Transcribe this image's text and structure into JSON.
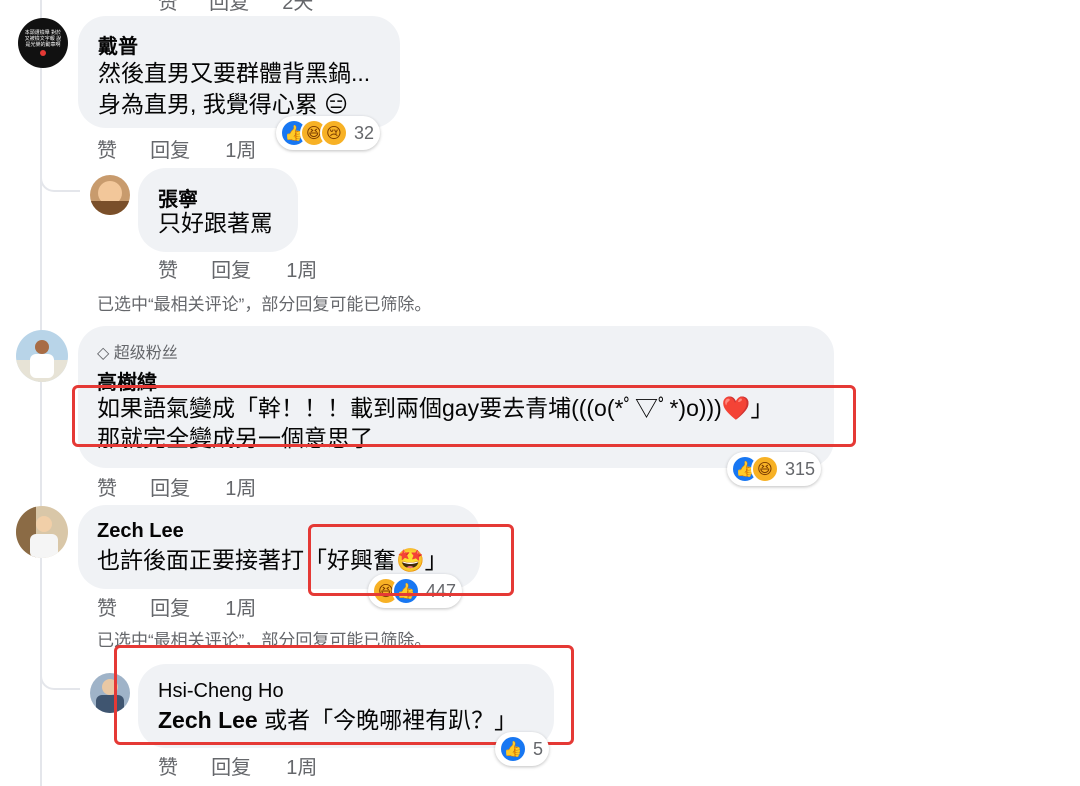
{
  "actions": {
    "like": "赞",
    "reply": "回复"
  },
  "filter_note": "已选中“最相关评论”，部分回复可能已筛除。",
  "top_actions": {
    "like": "赞",
    "reply": "回复",
    "time": "2天"
  },
  "comments": [
    {
      "author": "戴普",
      "lines": [
        "然後直男又要群體背黑鍋...",
        "身為直男, 我覺得心累 😑"
      ],
      "time": "1周",
      "reaction_count": "32",
      "avatar_text": "本頭遭檢舉 對於又被檢文字報 說是光榮的勳章啊"
    },
    {
      "author": "張寧",
      "lines": [
        "只好跟著罵"
      ],
      "time": "1周"
    },
    {
      "badge": "超级粉丝",
      "author": "高樹緯",
      "lines": [
        "如果語氣變成「幹！！！載到兩個gay要去青埔(((o(*ﾟ▽ﾟ*)o)))❤️」",
        "那就完全變成另一個意思了"
      ],
      "time": "1周",
      "reaction_count": "315"
    },
    {
      "author": "Zech Lee",
      "lines": [
        "也許後面正要接著打「好興奮🤩」"
      ],
      "time": "1周",
      "reaction_count": "447"
    },
    {
      "author": "Hsi-Cheng Ho",
      "mention": "Zech Lee",
      "lines": [
        "或者「今晚哪裡有趴？」"
      ],
      "time": "1周",
      "reaction_count": "5"
    }
  ],
  "colors": {
    "bubble": "#f0f2f5",
    "highlight": "#e53935",
    "like": "#1877f2",
    "muted": "#65676b"
  }
}
